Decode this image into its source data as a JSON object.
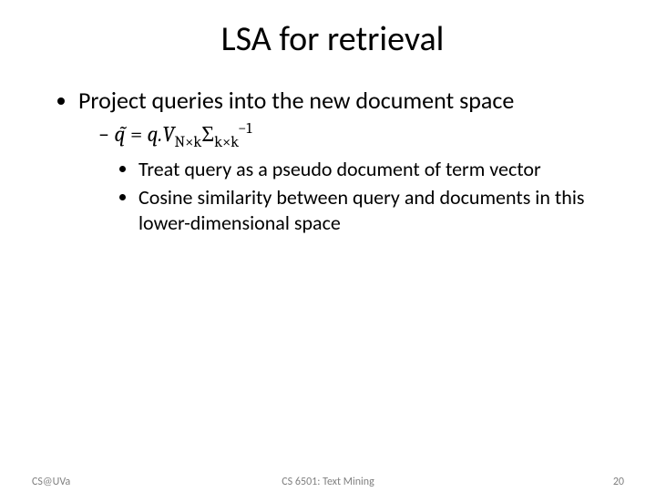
{
  "title": "LSA for retrieval",
  "bullets": {
    "l1": "Project queries into the new document space",
    "formula_lhs": "q̃",
    "formula_eq": " = ",
    "formula_q": "q.",
    "formula_V": "V",
    "formula_Vsub": "N×k",
    "formula_Sig": "Σ",
    "formula_Sigsub": "k×k",
    "formula_inv": "−1",
    "sub1": "Treat query as a pseudo document of term vector",
    "sub2": "Cosine similarity between query and documents in this lower-dimensional space"
  },
  "footer": {
    "left": "CS@UVa",
    "center": "CS 6501: Text Mining",
    "right": "20"
  }
}
